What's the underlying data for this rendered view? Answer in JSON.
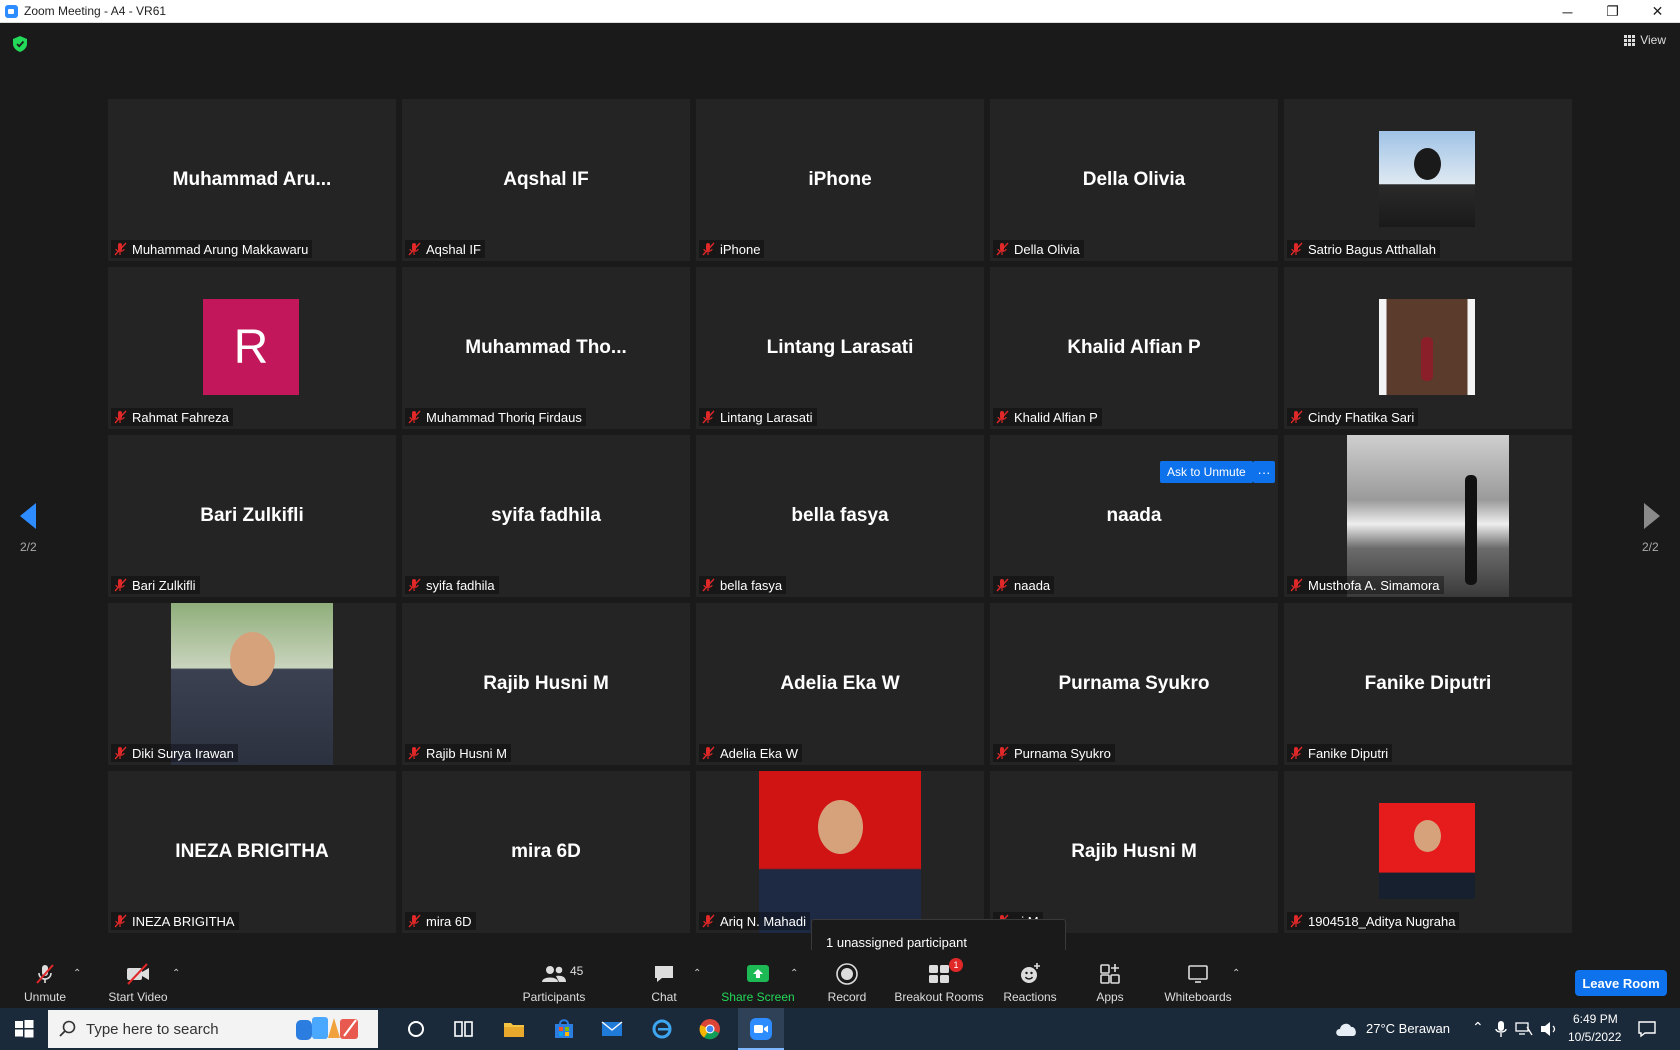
{
  "window": {
    "title": "Zoom Meeting - A4 - VR61",
    "minimize": "─",
    "restore": "❐",
    "close": "✕"
  },
  "view_button": {
    "label": "View"
  },
  "navigation": {
    "page_left": "2/2",
    "page_right": "2/2"
  },
  "tiles": [
    {
      "big": "Muhammad  Aru...",
      "label": "Muhammad Arung Makkawaru"
    },
    {
      "big": "Aqshal IF",
      "label": "Aqshal IF"
    },
    {
      "big": "iPhone",
      "label": "iPhone"
    },
    {
      "big": "Della Olivia",
      "label": "Della Olivia"
    },
    {
      "big": "",
      "label": "Satrio Bagus Atthallah"
    },
    {
      "big": "",
      "label": "Rahmat Fahreza",
      "avatar_letter": "R",
      "avatar_color": "#c2185b"
    },
    {
      "big": "Muhammad  Tho...",
      "label": "Muhammad Thoriq Firdaus"
    },
    {
      "big": "Lintang Larasati",
      "label": "Lintang Larasati"
    },
    {
      "big": "Khalid Alfian P",
      "label": "Khalid Alfian P"
    },
    {
      "big": "",
      "label": "Cindy Fhatika Sari"
    },
    {
      "big": "Bari Zulkifli",
      "label": "Bari Zulkifli"
    },
    {
      "big": "syifa fadhila",
      "label": "syifa fadhila"
    },
    {
      "big": "bella fasya",
      "label": "bella fasya"
    },
    {
      "big": "naada",
      "label": "naada"
    },
    {
      "big": "",
      "label": "Musthofa A. Simamora"
    },
    {
      "big": "",
      "label": "Diki Surya Irawan"
    },
    {
      "big": "Rajib Husni M",
      "label": "Rajib Husni M"
    },
    {
      "big": "Adelia Eka W",
      "label": "Adelia Eka W"
    },
    {
      "big": "Purnama Syukro",
      "label": "Purnama Syukro"
    },
    {
      "big": "Fanike Diputri",
      "label": "Fanike Diputri"
    },
    {
      "big": "INEZA BRIGITHA",
      "label": "INEZA BRIGITHA"
    },
    {
      "big": "mira 6D",
      "label": "mira 6D"
    },
    {
      "big": "",
      "label": "Ariq N. Mahadi"
    },
    {
      "big": "Rajib Husni M",
      "label": "ni M"
    },
    {
      "big": "",
      "label": "1904518_Aditya Nugraha"
    }
  ],
  "ask_unmute": {
    "label": "Ask to Unmute",
    "more": "···"
  },
  "tooltip": {
    "text": "1 unassigned participant"
  },
  "toolbar": {
    "unmute": "Unmute",
    "start_video": "Start Video",
    "participants": "Participants",
    "participants_count": "45",
    "chat": "Chat",
    "share_screen": "Share Screen",
    "record": "Record",
    "breakout_rooms": "Breakout Rooms",
    "breakout_badge": "1",
    "reactions": "Reactions",
    "apps": "Apps",
    "whiteboards": "Whiteboards",
    "leave_room": "Leave Room",
    "caret": "⌃"
  },
  "taskbar": {
    "search_placeholder": "Type here to search",
    "weather": "27°C  Berawan",
    "time": "6:49 PM",
    "date": "10/5/2022"
  },
  "colors": {
    "accent": "#0e72ed",
    "share_green": "#1db954",
    "badge_red": "#e02828",
    "mic_muted": "#e02828"
  }
}
